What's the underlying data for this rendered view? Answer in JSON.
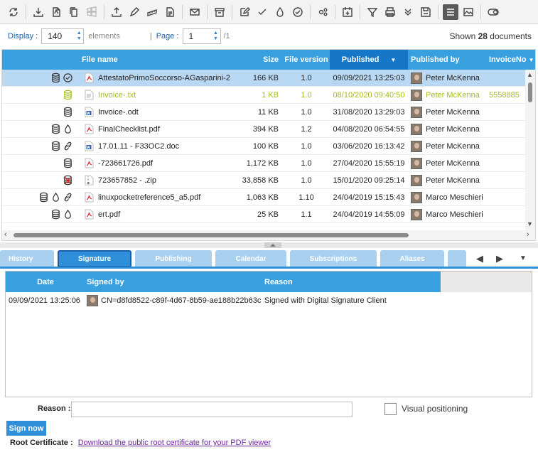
{
  "toolbar": {
    "icons": [
      "refresh-icon",
      "download-icon",
      "pdf-icon",
      "copy-icon",
      "windows-icon",
      "upload-icon",
      "pen-icon",
      "ruler-icon",
      "document-icon",
      "mail-icon",
      "archive-icon",
      "edit-icon",
      "check-icon",
      "drop-icon",
      "check-circle-icon",
      "settings-icon",
      "calendar-add-icon",
      "filter-icon",
      "print-icon",
      "chevron-double-down-icon",
      "save-icon",
      "list-view-icon",
      "image-view-icon",
      "toggle-icon"
    ]
  },
  "display_bar": {
    "display_label": "Display :",
    "display_value": "140",
    "elements_label": "elements",
    "pipe": "|",
    "page_label": "Page :",
    "page_value": "1",
    "page_total": "/1",
    "shown_prefix": "Shown",
    "shown_count": "28",
    "shown_suffix": "documents"
  },
  "grid": {
    "columns": {
      "file_name": "File name",
      "size": "Size",
      "file_version": "File version",
      "published": "Published",
      "published_by": "Published by",
      "invoice_no": "InvoiceNo"
    },
    "rows": [
      {
        "icons": [
          "db",
          "check-circle"
        ],
        "file_icon": "pdf",
        "name": "AttestatoPrimoSoccorso-AGasparini-2",
        "size": "166 KB",
        "version": "1.0",
        "published": "09/09/2021 13:25:03",
        "by": "Peter McKenna",
        "invoice": ""
      },
      {
        "icons": [
          "db"
        ],
        "file_icon": "txt",
        "name": "Invoice-.txt",
        "size": "1 KB",
        "version": "1.0",
        "published": "08/10/2020 09:40:50",
        "by": "Peter McKenna",
        "invoice": "5558885"
      },
      {
        "icons": [
          "db"
        ],
        "file_icon": "doc",
        "name": "Invoice-.odt",
        "size": "11 KB",
        "version": "1.0",
        "published": "31/08/2020 13:29:03",
        "by": "Peter McKenna",
        "invoice": ""
      },
      {
        "icons": [
          "db",
          "drop"
        ],
        "file_icon": "pdf",
        "name": "FinalChecklist.pdf",
        "size": "394 KB",
        "version": "1.2",
        "published": "04/08/2020 06:54:55",
        "by": "Peter McKenna",
        "invoice": ""
      },
      {
        "icons": [
          "db",
          "link"
        ],
        "file_icon": "doc",
        "name": "17.01.11 - F33OC2.doc",
        "size": "100 KB",
        "version": "1.0",
        "published": "03/06/2020 16:13:42",
        "by": "Peter McKenna",
        "invoice": ""
      },
      {
        "icons": [
          "db"
        ],
        "file_icon": "pdf",
        "name": "-723661726.pdf",
        "size": "1,172 KB",
        "version": "1.0",
        "published": "27/04/2020 15:55:19",
        "by": "Peter McKenna",
        "invoice": ""
      },
      {
        "icons": [
          "db-x"
        ],
        "file_icon": "zip",
        "name": "723657852 - .zip",
        "size": "33,858 KB",
        "version": "1.0",
        "published": "15/01/2020 09:25:14",
        "by": "Peter McKenna",
        "invoice": ""
      },
      {
        "icons": [
          "db",
          "drop",
          "link"
        ],
        "file_icon": "pdf",
        "name": "linuxpocketreference5_a5.pdf",
        "size": "1,063 KB",
        "version": "1.10",
        "published": "24/04/2019 15:15:43",
        "by": "Marco Meschieri",
        "invoice": ""
      },
      {
        "icons": [
          "db",
          "drop"
        ],
        "file_icon": "pdf",
        "name": "ert.pdf",
        "size": "25 KB",
        "version": "1.1",
        "published": "24/04/2019 14:55:09",
        "by": "Marco Meschieri",
        "invoice": ""
      }
    ]
  },
  "tabs": [
    "History",
    "Signature",
    "Publishing",
    "Calendar",
    "Subscriptions",
    "Aliases"
  ],
  "active_tab": "Signature",
  "signature": {
    "columns": {
      "date": "Date",
      "signed_by": "Signed by",
      "reason": "Reason"
    },
    "rows": [
      {
        "date": "09/09/2021 13:25:06",
        "signed_by": "CN=d8fd8522-c89f-4d67-8b59-ae188b22b63c",
        "reason": "Signed with Digital Signature Client"
      }
    ],
    "reason_label": "Reason :",
    "reason_value": "",
    "visual_positioning_label": "Visual positioning",
    "sign_now_label": "Sign now",
    "root_cert_label": "Root Certificate :",
    "root_cert_link": "Download the public root certificate for your PDF viewer"
  },
  "colors": {
    "accent": "#39a0e0",
    "accent_dark": "#1677c9",
    "selected_row": "#b9d8f3",
    "highlight_text": "#a7bb1a",
    "link": "#6b2a9c"
  }
}
